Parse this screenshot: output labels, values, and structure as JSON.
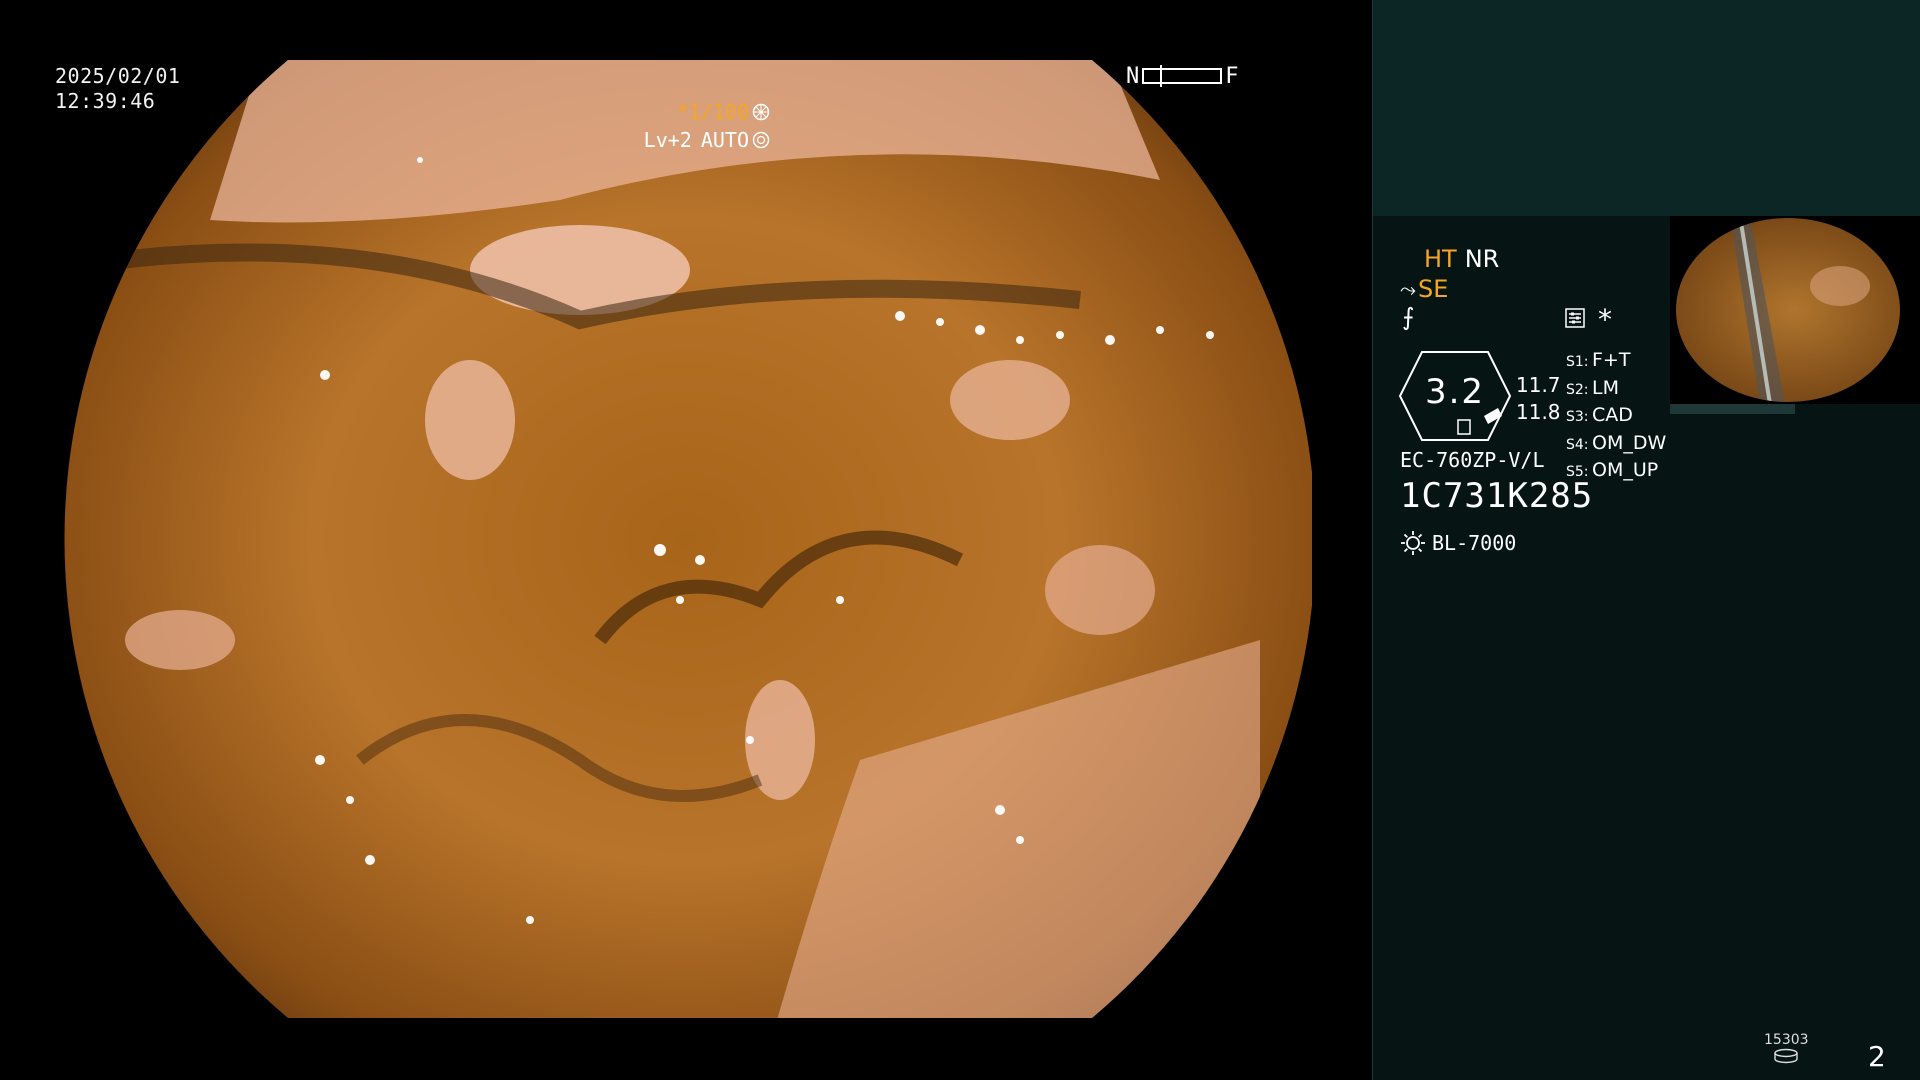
{
  "overlay": {
    "date": "2025/02/01",
    "time": "12:39:46",
    "near_label": "N",
    "far_label": "F",
    "shutter": "*1/100",
    "level": "Lv+2",
    "exposure": "AUTO"
  },
  "panel": {
    "mode_ht": "HT",
    "mode_nr": "NR",
    "mode_se": "SE",
    "asterisk": "*",
    "zoom": "3.2",
    "pressure_top": "11.7",
    "pressure_bottom": "11.8",
    "switches": [
      {
        "key": "S1:",
        "value": "F+T"
      },
      {
        "key": "S2:",
        "value": "LM"
      },
      {
        "key": "S3:",
        "value": "CAD"
      },
      {
        "key": "S4:",
        "value": "OM_DW"
      },
      {
        "key": "S5:",
        "value": "OM_UP"
      }
    ],
    "scope_model": "EC-760ZP-V/L",
    "scope_serial": "1C731K285",
    "light_source": "BL-7000",
    "image_counter": "15303",
    "page_number": "2"
  },
  "colors": {
    "accent_orange": "#f5a623",
    "panel_top": "#0b2625",
    "panel_bottom": "#071414"
  },
  "icons": [
    "sun-icon",
    "shutter-icon",
    "auto-iris-icon",
    "disk-icon",
    "settings-icon"
  ]
}
